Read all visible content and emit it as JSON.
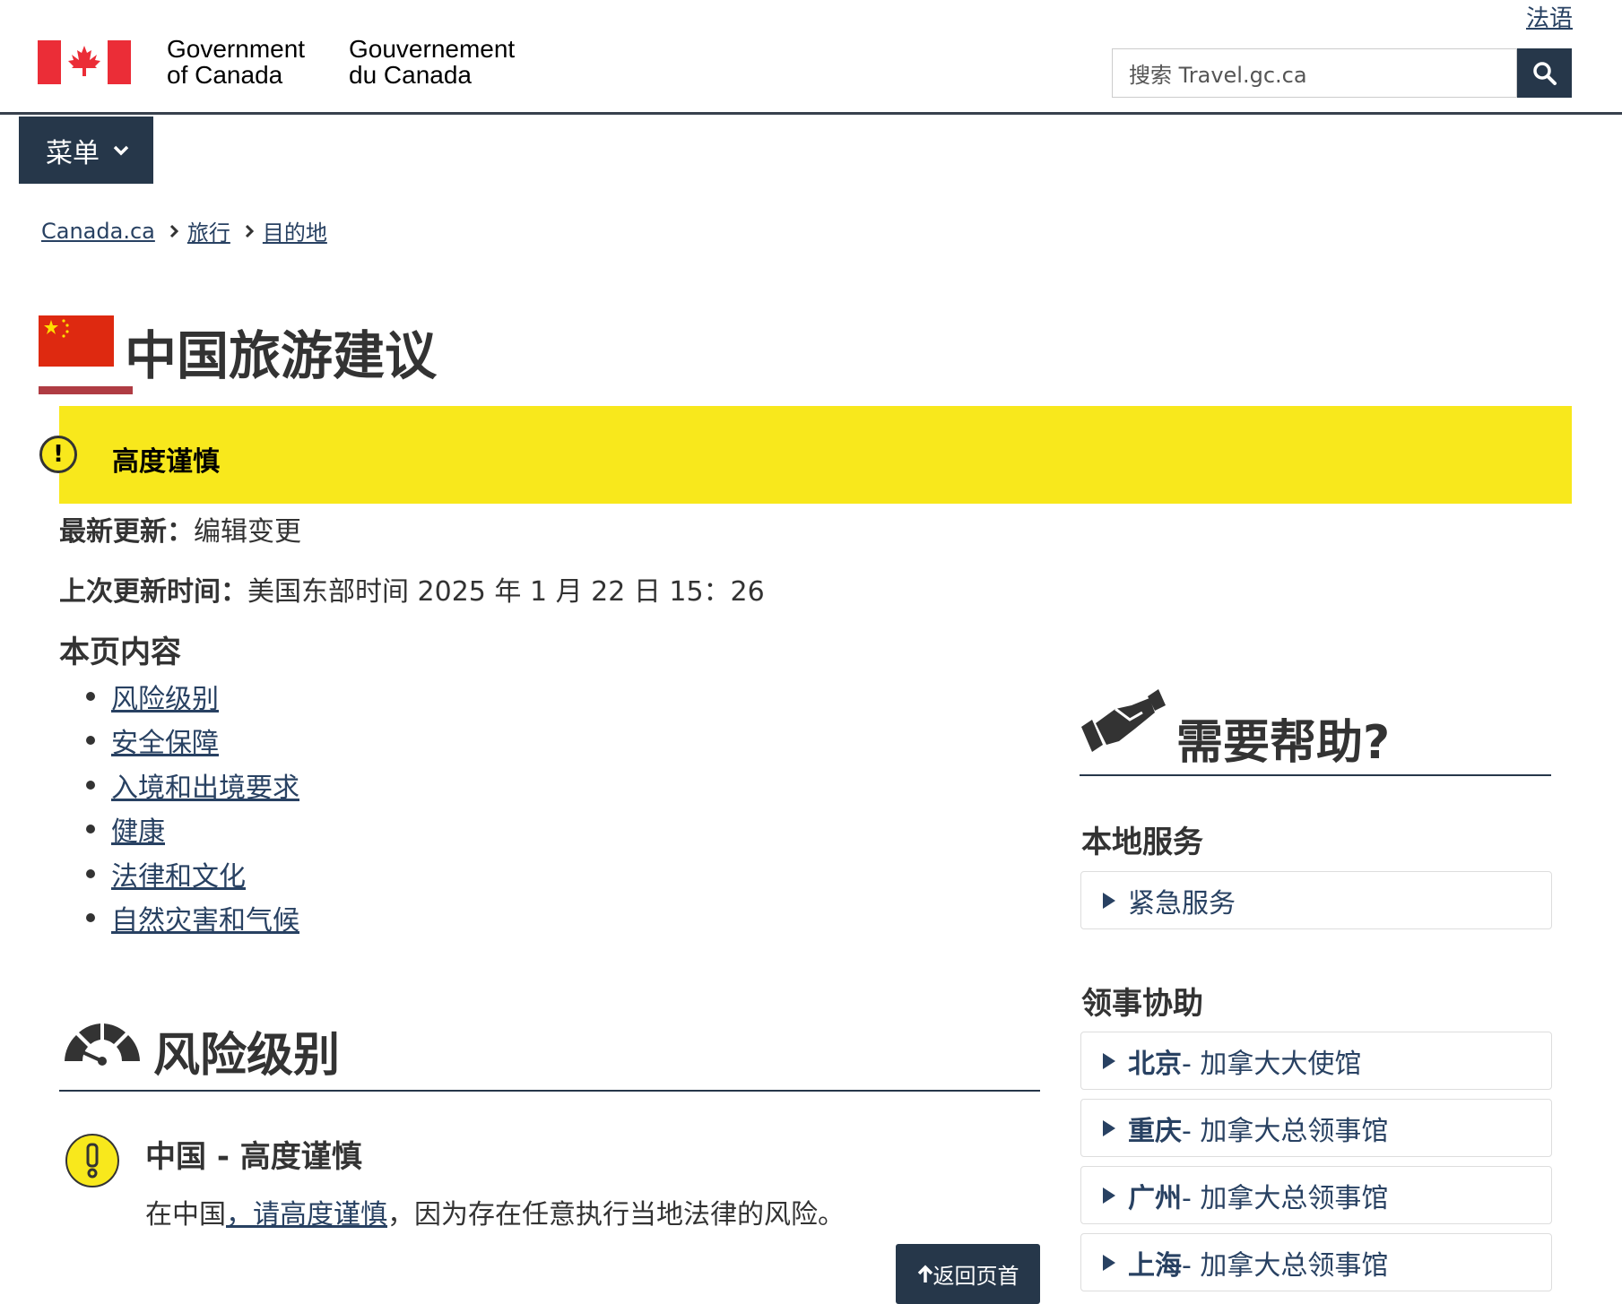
{
  "header": {
    "lang_link": "法语",
    "sig_en_line1": "Government",
    "sig_en_line2": "of Canada",
    "sig_fr_line1": "Gouvernement",
    "sig_fr_line2": "du Canada",
    "search_placeholder": "搜索 Travel.gc.ca"
  },
  "menu": {
    "label": "菜单"
  },
  "breadcrumb": [
    "Canada.ca",
    "旅行",
    "目的地"
  ],
  "page": {
    "title": "中国旅游建议",
    "alert": "高度谨慎",
    "latest_update_label": "最新更新：",
    "latest_update_value": "编辑变更",
    "last_updated_label": "上次更新时间：",
    "last_updated_value": "美国东部时间 2025 年 1 月 22 日 15：26",
    "toc_title": "本页内容",
    "toc": [
      "风险级别",
      "安全保障",
      "入境和出境要求",
      "健康",
      "法律和文化",
      "自然灾害和气候"
    ]
  },
  "risk": {
    "heading": "风险级别",
    "sub": "中国 - 高度谨慎",
    "desc_prefix": "在中国",
    "desc_link": "，请高度谨慎",
    "desc_suffix": "，因为存在任意执行当地法律的风险。",
    "back_to_top": "返回页首"
  },
  "help": {
    "heading": "需要帮助?",
    "local_services_title": "本地服务",
    "local_services": [
      "紧急服务"
    ],
    "consular_title": "领事协助",
    "consular": [
      {
        "city": "北京",
        "office": " - 加拿大大使馆"
      },
      {
        "city": "重庆",
        "office": " - 加拿大总领事馆"
      },
      {
        "city": "广州",
        "office": " - 加拿大总领事馆"
      },
      {
        "city": "上海",
        "office": " - 加拿大总领事馆"
      }
    ]
  },
  "colors": {
    "navy": "#26374a",
    "link": "#284162",
    "alert_yellow": "#f8e81c",
    "accent_red": "#af3c43"
  }
}
